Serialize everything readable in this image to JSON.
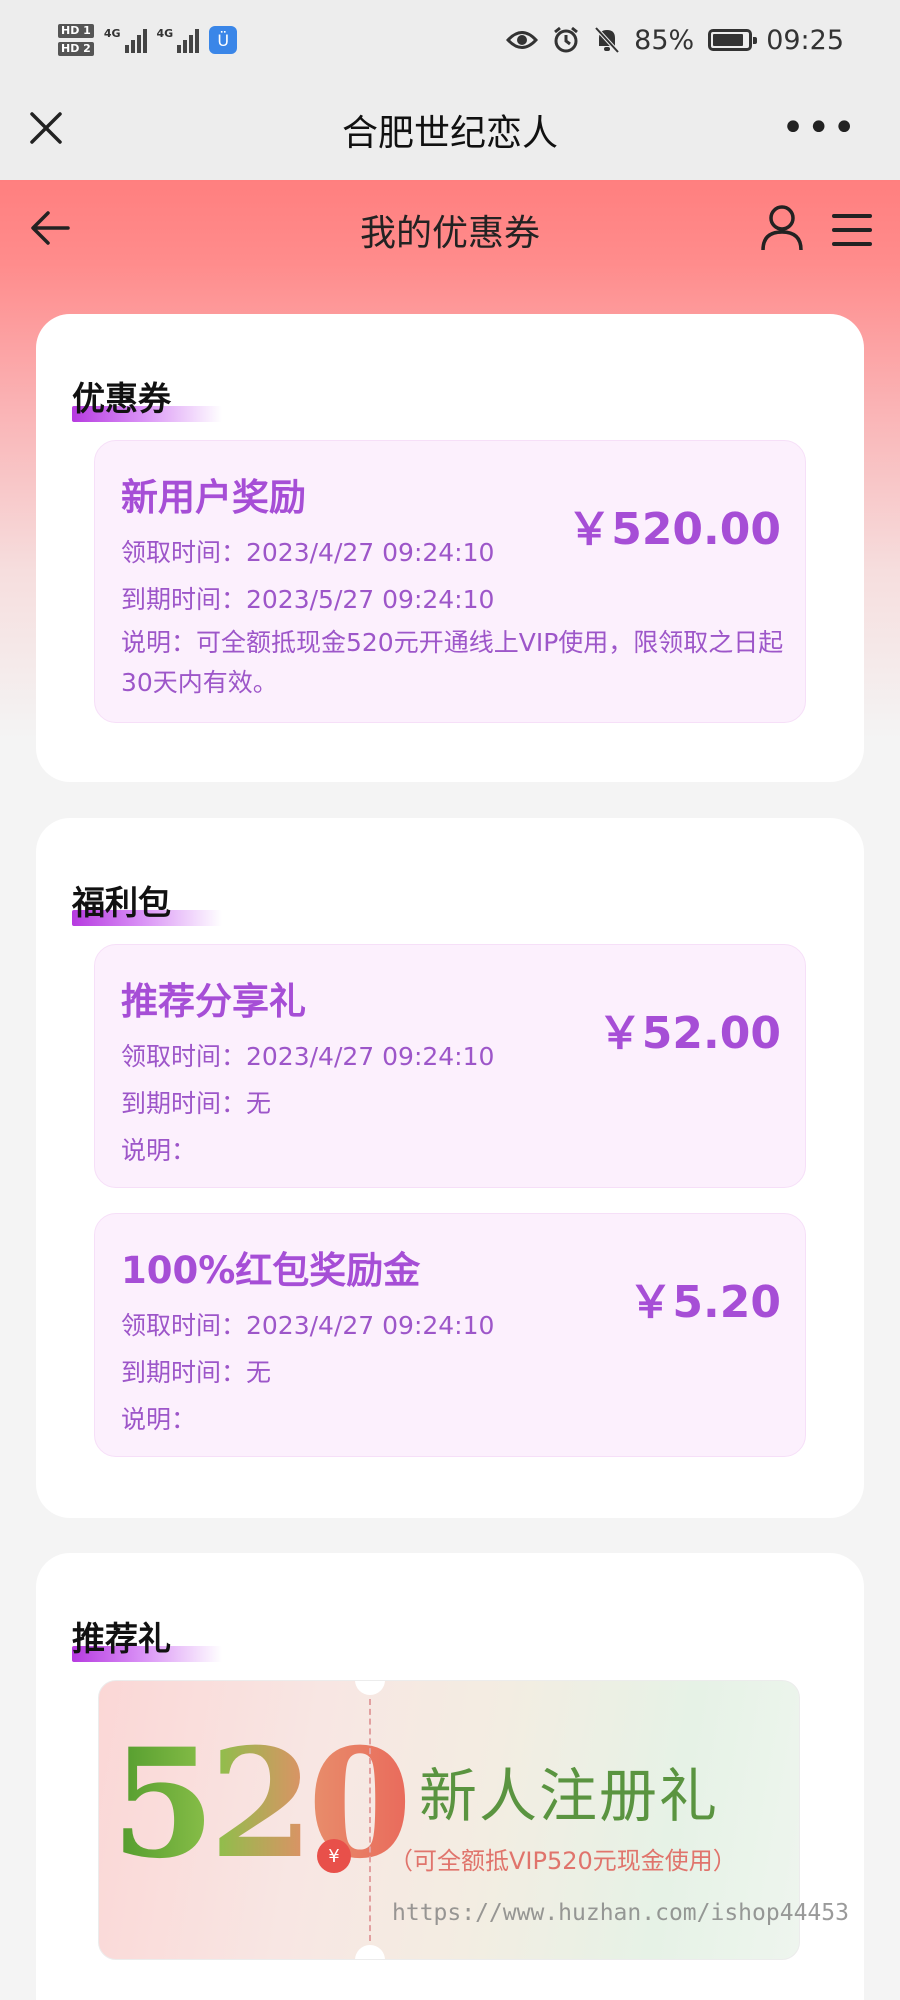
{
  "status": {
    "hd1": "HD 1",
    "hd2": "HD 2",
    "net1": "4G",
    "net2": "4G",
    "app_badge": "Ü",
    "battery": "85%",
    "time": "09:25"
  },
  "titlebar": {
    "title": "合肥世纪恋人",
    "more": "•••"
  },
  "nav": {
    "title": "我的优惠券"
  },
  "sections": {
    "coupons": {
      "title": "优惠券",
      "items": [
        {
          "name": "新用户奖励",
          "receive": "领取时间：2023/4/27 09:24:10",
          "expire": "到期时间：2023/5/27 09:24:10",
          "desc": "说明：可全额抵现金520元开通线上VIP使用，限领取之日起30天内有效。",
          "amount": "￥520.00"
        }
      ]
    },
    "welfare": {
      "title": "福利包",
      "items": [
        {
          "name": "推荐分享礼",
          "receive": "领取时间：2023/4/27 09:24:10",
          "expire": "到期时间：无",
          "desc": "说明：",
          "amount": "￥52.00"
        },
        {
          "name": "100%红包奖励金",
          "receive": "领取时间：2023/4/27 09:24:10",
          "expire": "到期时间：无",
          "desc": "说明：",
          "amount": "￥5.20"
        }
      ]
    },
    "recommend": {
      "title": "推荐礼",
      "ticket": {
        "big": "520",
        "yen": "¥",
        "title": "新人注册礼",
        "sub": "（可全额抵VIP520元现金使用）"
      }
    }
  },
  "watermark": "https://www.huzhan.com/ishop44453",
  "colors": {
    "accent": "#a64ed6",
    "header_gradient_top": "#ff7f7f",
    "coupon_bg": "#fcf0fd"
  }
}
